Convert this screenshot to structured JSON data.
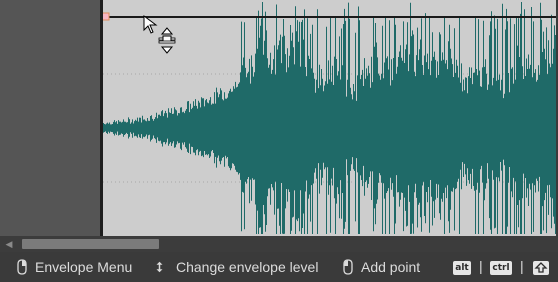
{
  "statusbar": {
    "envelope_menu": "Envelope Menu",
    "change_level": "Change envelope level",
    "add_point": "Add point",
    "keys": [
      "alt",
      "ctrl",
      "shift-arrow"
    ],
    "separator": "|"
  },
  "colors": {
    "waveform": "#1f6a68",
    "wave_background": "#cdcdcd",
    "envelope_point": "#f7b6c4",
    "envelope_line": "#1a1a1a"
  },
  "icons": [
    "mouse-right-icon",
    "updown-arrow-icon",
    "mouse-left-icon",
    "arrow-cursor-icon",
    "envelope-level-cursor-icon"
  ]
}
